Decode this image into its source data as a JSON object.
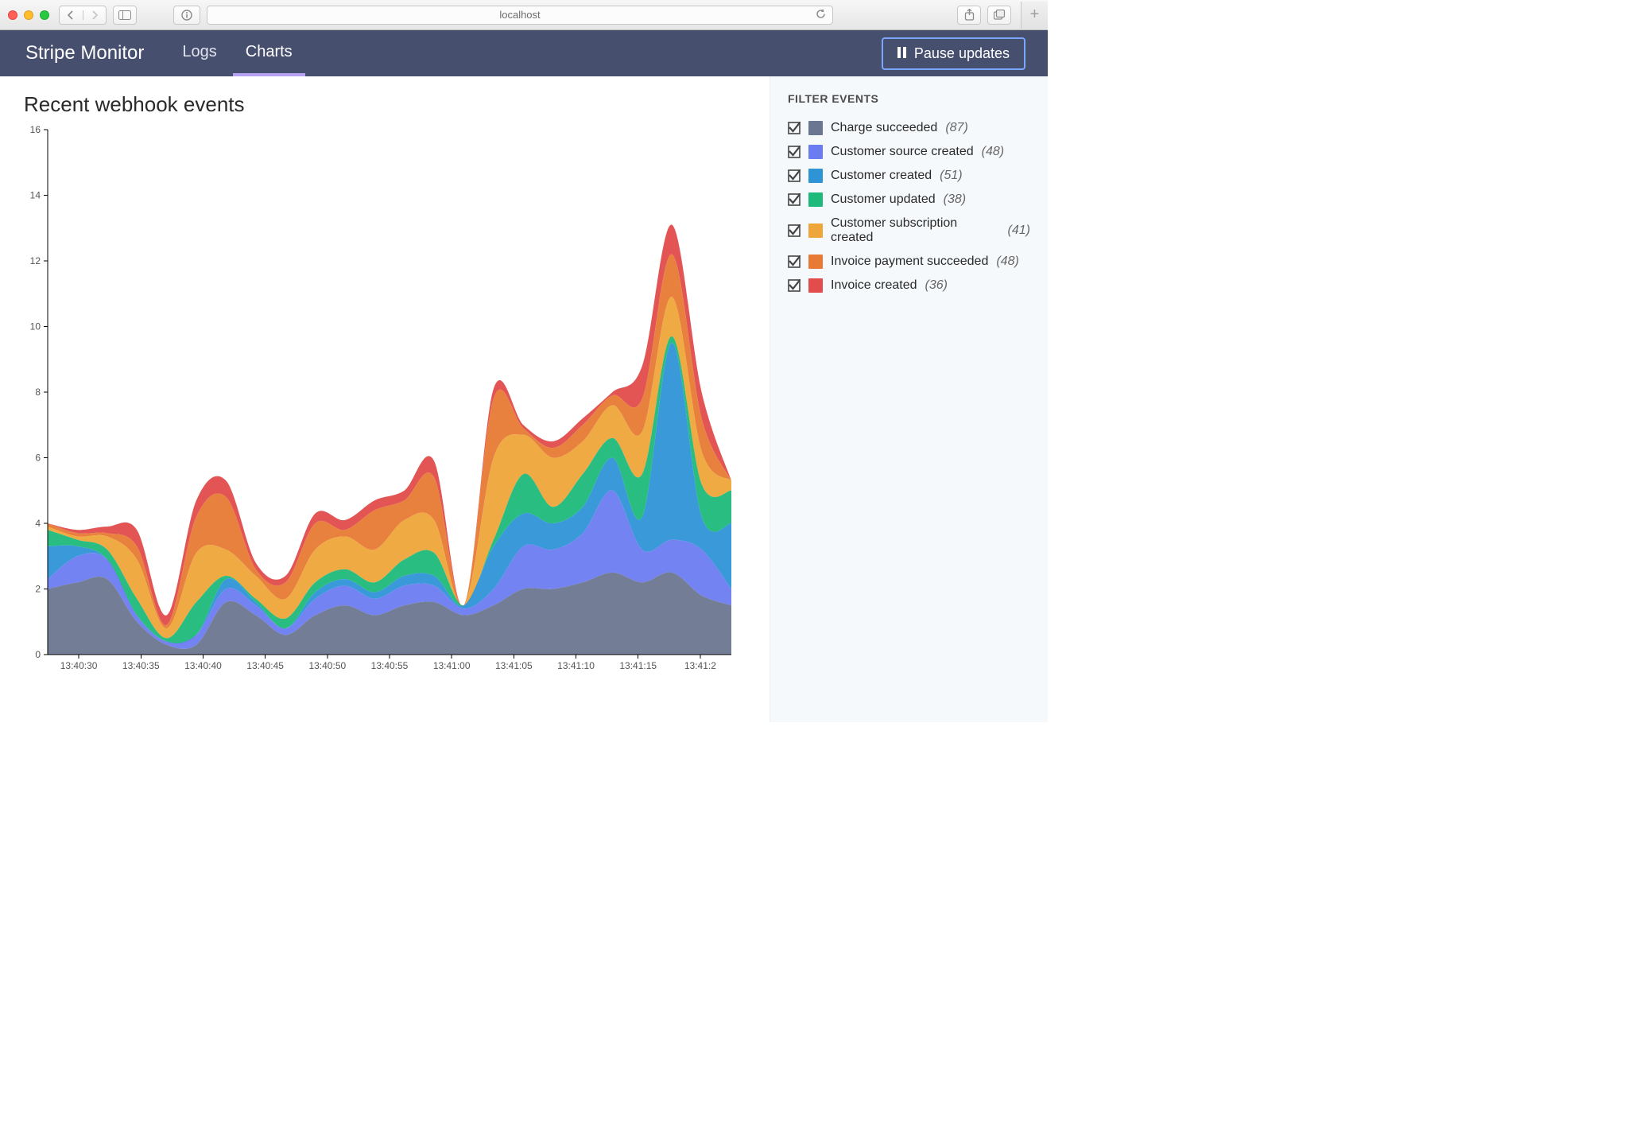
{
  "browser": {
    "url_display": "localhost"
  },
  "header": {
    "title": "Stripe Monitor",
    "tabs": [
      {
        "label": "Logs",
        "active": false
      },
      {
        "label": "Charts",
        "active": true
      }
    ],
    "pause_label": "Pause updates"
  },
  "chart": {
    "title": "Recent webhook events"
  },
  "sidebar": {
    "heading": "Filter events",
    "items": [
      {
        "label": "Charge succeeded",
        "count": "(87)",
        "color": "#6b7790",
        "checked": true
      },
      {
        "label": "Customer source created",
        "count": "(48)",
        "color": "#6b7cf0",
        "checked": true
      },
      {
        "label": "Customer created",
        "count": "(51)",
        "color": "#2f94d6",
        "checked": true
      },
      {
        "label": "Customer updated",
        "count": "(38)",
        "color": "#1eb97b",
        "checked": true
      },
      {
        "label": "Customer subscription created",
        "count": "(41)",
        "color": "#eea53a",
        "checked": true
      },
      {
        "label": "Invoice payment succeeded",
        "count": "(48)",
        "color": "#e77a34",
        "checked": true
      },
      {
        "label": "Invoice created",
        "count": "(36)",
        "color": "#e24c4c",
        "checked": true
      }
    ]
  },
  "chart_data": {
    "type": "area",
    "stacked": true,
    "title": "Recent webhook events",
    "xlabel": "",
    "ylabel": "",
    "ylim": [
      0,
      16
    ],
    "yticks": [
      0,
      2,
      4,
      6,
      8,
      10,
      12,
      14,
      16
    ],
    "xticks": [
      "13:40:30",
      "13:40:35",
      "13:40:40",
      "13:40:45",
      "13:40:50",
      "13:40:55",
      "13:41:00",
      "13:41:05",
      "13:41:10",
      "13:41:15",
      "13:41:2"
    ],
    "x": [
      "13:40:27",
      "13:40:30",
      "13:40:32",
      "13:40:34",
      "13:40:35",
      "13:40:37",
      "13:40:40",
      "13:40:42",
      "13:40:44",
      "13:40:45",
      "13:40:48",
      "13:40:50",
      "13:40:53",
      "13:40:55",
      "13:40:58",
      "13:41:00",
      "13:41:02",
      "13:41:05",
      "13:41:08",
      "13:41:10",
      "13:41:13",
      "13:41:15",
      "13:41:18",
      "13:41:20"
    ],
    "series": [
      {
        "name": "Charge succeeded",
        "color": "#6b7790",
        "values": [
          2.0,
          2.2,
          2.3,
          1.0,
          0.3,
          0.3,
          1.6,
          1.2,
          0.6,
          1.2,
          1.5,
          1.2,
          1.5,
          1.6,
          1.2,
          1.5,
          2.0,
          2.0,
          2.2,
          2.5,
          2.2,
          2.5,
          1.8,
          1.5
        ]
      },
      {
        "name": "Customer source created",
        "color": "#6b7cf0",
        "values": [
          0.3,
          0.8,
          0.6,
          0.2,
          0.1,
          0.3,
          0.4,
          0.3,
          0.2,
          0.5,
          0.6,
          0.5,
          0.6,
          0.5,
          0.2,
          0.5,
          1.3,
          1.2,
          1.5,
          2.5,
          1.0,
          1.0,
          1.4,
          0.5
        ]
      },
      {
        "name": "Customer created",
        "color": "#2f94d6",
        "values": [
          1.0,
          0.3,
          0.0,
          0.0,
          0.0,
          0.0,
          0.3,
          0.1,
          0.0,
          0.2,
          0.2,
          0.2,
          0.3,
          0.3,
          0.1,
          1.3,
          1.0,
          0.8,
          0.8,
          1.0,
          1.0,
          6.0,
          1.0,
          2.0
        ]
      },
      {
        "name": "Customer updated",
        "color": "#1eb97b",
        "values": [
          0.5,
          0.2,
          0.3,
          0.5,
          0.1,
          1.0,
          0.1,
          0.1,
          0.3,
          0.3,
          0.3,
          0.3,
          0.5,
          0.7,
          0.0,
          0.2,
          1.2,
          0.5,
          1.0,
          0.6,
          1.3,
          0.2,
          1.0,
          1.0
        ]
      },
      {
        "name": "Customer subscription created",
        "color": "#eea53a",
        "values": [
          0.1,
          0.1,
          0.4,
          1.2,
          0.3,
          1.5,
          0.8,
          0.7,
          0.6,
          1.0,
          1.0,
          1.0,
          1.2,
          1.0,
          0.0,
          2.5,
          1.2,
          1.5,
          1.0,
          1.0,
          1.3,
          1.2,
          1.0,
          0.3
        ]
      },
      {
        "name": "Invoice payment succeeded",
        "color": "#e77a34",
        "values": [
          0.1,
          0.1,
          0.1,
          0.4,
          0.1,
          1.1,
          1.6,
          0.2,
          0.5,
          0.8,
          0.2,
          1.2,
          0.6,
          1.3,
          0.0,
          1.8,
          0.2,
          0.3,
          0.5,
          0.3,
          1.0,
          1.3,
          1.0,
          0.0
        ]
      },
      {
        "name": "Invoice created",
        "color": "#e24c4c",
        "values": [
          0.0,
          0.1,
          0.2,
          0.5,
          0.3,
          0.5,
          0.5,
          0.2,
          0.2,
          0.3,
          0.3,
          0.3,
          0.3,
          0.5,
          0.0,
          0.3,
          0.1,
          0.2,
          0.2,
          0.1,
          1.0,
          0.9,
          0.8,
          0.0
        ]
      }
    ]
  }
}
